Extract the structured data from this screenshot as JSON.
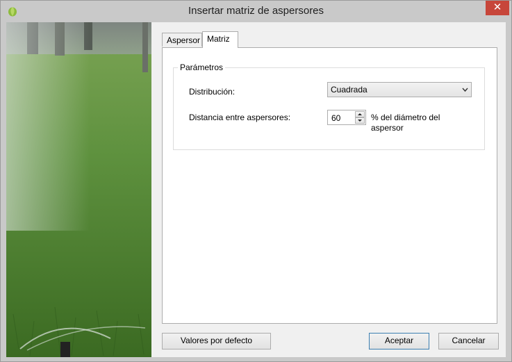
{
  "window": {
    "title": "Insertar matriz de aspersores",
    "close_glyph": "✕",
    "icon": "app-leaf-icon",
    "accent_color": "#c7463a"
  },
  "tabs": [
    {
      "label": "Aspersor",
      "active": false
    },
    {
      "label": "Matriz",
      "active": true
    }
  ],
  "params": {
    "group_title": "Parámetros",
    "distribution_label": "Distribución:",
    "distribution_value": "Cuadrada",
    "distance_label": "Distancia entre aspersores:",
    "distance_value": "60",
    "distance_suffix": "% del diámetro del aspersor"
  },
  "buttons": {
    "defaults": "Valores por defecto",
    "accept": "Aceptar",
    "cancel": "Cancelar"
  }
}
